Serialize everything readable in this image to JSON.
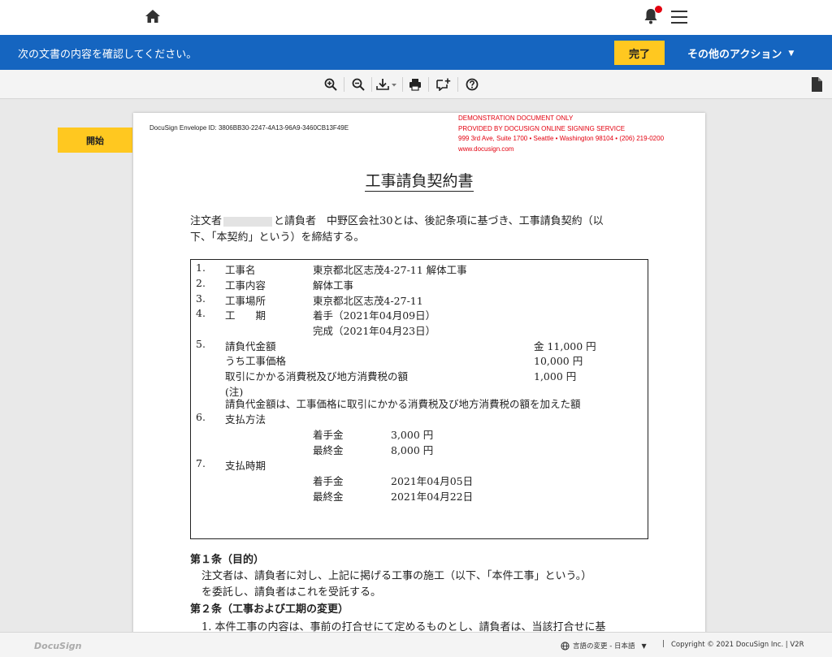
{
  "header": {
    "home_icon": "home-icon",
    "bell_icon": "bell-icon",
    "menu_icon": "hamburger-menu-icon"
  },
  "action_bar": {
    "message": "次の文書の内容を確認してください。",
    "finish_label": "完了",
    "other_actions_label": "その他のアクション",
    "accent_color": "#1565c0",
    "button_color": "#ffc820"
  },
  "toolbar": {
    "icons": [
      "zoom-in-icon",
      "zoom-out-icon",
      "download-icon",
      "print-icon",
      "comment-add-icon",
      "help-icon",
      "document-icon"
    ]
  },
  "start_tab": {
    "label": "開始"
  },
  "document": {
    "envelope_id": "DocuSign Envelope ID: 3806BB30-2247-4A13-96A9-3460CB13F49E",
    "demo_notice": [
      "DEMONSTRATION DOCUMENT ONLY",
      "PROVIDED BY DOCUSIGN ONLINE SIGNING SERVICE",
      "999 3rd Ave, Suite 1700  • Seattle • Washington 98104 • (206) 219-0200",
      "www.docusign.com"
    ],
    "title": "工事請負契約書",
    "intro_part1": "注文者",
    "intro_part2": "と請負者　中野区会社30とは、後記条項に基づき、工事請負契約（以",
    "intro_line2": "下、「本契約」という）を締結する。",
    "items": {
      "n1": "1.",
      "l1": "工事名",
      "v1": "東京都北区志茂4-27-11 解体工事",
      "n2": "2.",
      "l2": "工事内容",
      "v2": "解体工事",
      "n3": "3.",
      "l3": "工事場所",
      "v3": "東京都北区志茂4-27-11",
      "n4": "4.",
      "l4": "工　　期",
      "v4a": "着手（2021年04月09日）",
      "v4b": "完成（2021年04月23日）",
      "n5": "5.",
      "l5": "請負代金額",
      "a5": "金 11,000 円",
      "l5b": "うち工事価格",
      "a5b": "10,000 円",
      "l5c": "取引にかかる消費税及び地方消費税の額",
      "a5c": "1,000 円",
      "l5d": "(注)",
      "l5e": "請負代金額は、工事価格に取引にかかる消費税及び地方消費税の額を加えた額",
      "n6": "6.",
      "l6": "支払方法",
      "p6a_label": "着手金",
      "p6a_value": "3,000 円",
      "p6b_label": "最終金",
      "p6b_value": "8,000 円",
      "n7": "7.",
      "l7": "支払時期",
      "p7a_label": "着手金",
      "p7a_value": "2021年04月05日",
      "p7b_label": "最終金",
      "p7b_value": "2021年04月22日"
    },
    "article1_title": "第１条（目的）",
    "article1_line1": "注文者は、請負者に対し、上記に掲げる工事の施工（以下、「本件工事」という。）",
    "article1_line2": "を委託し、請負者はこれを受託する。",
    "article2_title": "第２条（工事および工期の変更）",
    "article2_line1": "1.  本件工事の内容は、事前の打合せにて定めるものとし、請負者は、当該打合せに基"
  },
  "footer": {
    "logo": "DocuSign",
    "language_label": "言語の変更 - 日本語",
    "separator": "|",
    "copyright": "Copyright © 2021 DocuSign Inc.  |  V2R"
  }
}
